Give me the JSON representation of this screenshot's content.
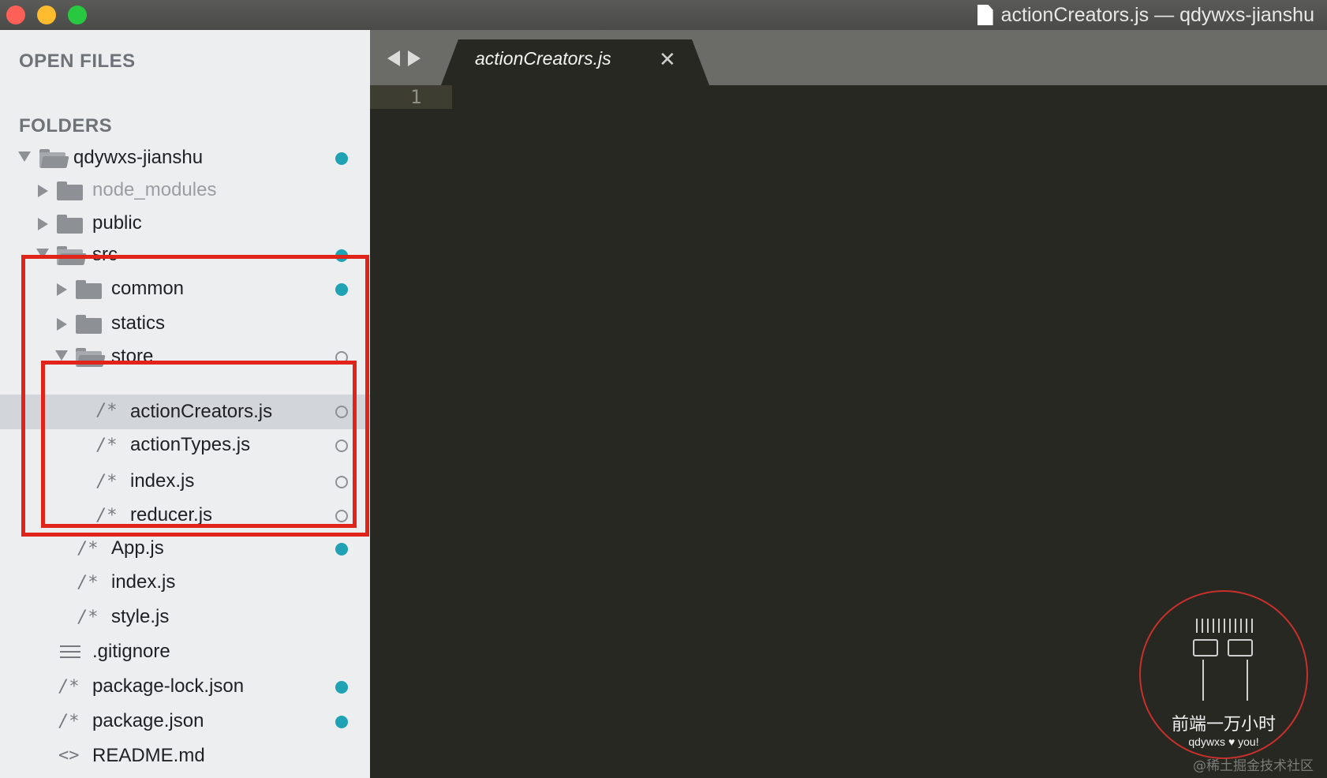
{
  "window": {
    "title": "actionCreators.js — qdywxs-jianshu"
  },
  "sidebar": {
    "open_files_label": "OPEN FILES",
    "folders_label": "FOLDERS",
    "tree": [
      {
        "label": "qdywxs-jianshu",
        "kind": "folder-open",
        "status": "modified"
      },
      {
        "label": "node_modules",
        "kind": "folder",
        "status": "none"
      },
      {
        "label": "public",
        "kind": "folder",
        "status": "none"
      },
      {
        "label": "src",
        "kind": "folder-open",
        "status": "modified"
      },
      {
        "label": "common",
        "kind": "folder",
        "status": "modified"
      },
      {
        "label": "statics",
        "kind": "folder",
        "status": "none"
      },
      {
        "label": "store",
        "kind": "folder-open",
        "status": "untracked"
      },
      {
        "label": "actionCreators.js",
        "kind": "js-file",
        "status": "untracked",
        "selected": true
      },
      {
        "label": "actionTypes.js",
        "kind": "js-file",
        "status": "untracked"
      },
      {
        "label": "index.js",
        "kind": "js-file",
        "status": "untracked"
      },
      {
        "label": "reducer.js",
        "kind": "js-file",
        "status": "untracked"
      },
      {
        "label": "App.js",
        "kind": "js-file",
        "status": "modified"
      },
      {
        "label": "index.js",
        "kind": "js-file",
        "status": "none"
      },
      {
        "label": "style.js",
        "kind": "js-file",
        "status": "none"
      },
      {
        "label": ".gitignore",
        "kind": "text-file",
        "status": "none"
      },
      {
        "label": "package-lock.json",
        "kind": "js-file",
        "status": "modified"
      },
      {
        "label": "package.json",
        "kind": "js-file",
        "status": "modified"
      },
      {
        "label": "README.md",
        "kind": "markup-file",
        "status": "none"
      }
    ],
    "file_icon_glyph": "/*",
    "markup_icon_glyph": "<>"
  },
  "editor": {
    "tab_label": "actionCreators.js",
    "tab_close_glyph": "✕",
    "line_numbers": [
      "1"
    ]
  },
  "watermark": {
    "name": "前端一万小时",
    "tagline": "qdywxs ♥ you!",
    "site": "@稀土掘金技术社区"
  },
  "colors": {
    "modified_dot": "#1fa3b4",
    "annotation_red": "#e0241a",
    "editor_bg": "#272822",
    "sidebar_bg": "#eceef0"
  }
}
